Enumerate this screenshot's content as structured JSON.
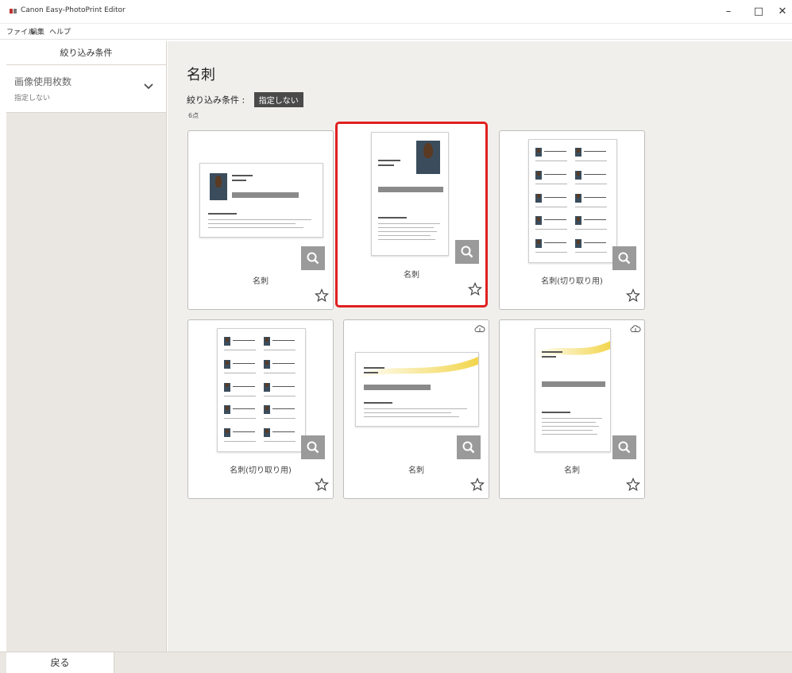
{
  "window": {
    "title": "Canon Easy-PhotoPrint Editor",
    "minimize": "–",
    "maximize": "□",
    "close": "✕"
  },
  "menu": [
    "ファイル",
    "編集",
    "ヘルプ"
  ],
  "sidebar": {
    "header": "絞り込み条件",
    "filter_title": "画像使用枚数",
    "filter_value": "指定しない"
  },
  "main": {
    "title": "名刺",
    "filter_label": "絞り込み条件 :",
    "filter_chip": "指定しない",
    "count": "6点"
  },
  "cards": [
    {
      "label": "名刺",
      "selected": false,
      "cloud": false
    },
    {
      "label": "名刺",
      "selected": true,
      "cloud": false
    },
    {
      "label": "名刺(切り取り用)",
      "selected": false,
      "cloud": false
    },
    {
      "label": "名刺(切り取り用)",
      "selected": false,
      "cloud": false
    },
    {
      "label": "名刺",
      "selected": false,
      "cloud": true
    },
    {
      "label": "名刺",
      "selected": false,
      "cloud": true
    }
  ],
  "footer": {
    "back": "戻る"
  },
  "colors": {
    "selection": "#e02020",
    "zoom_button": "#9a9a9a",
    "chip_bg": "#4a4a4a",
    "yellow_accent": "#f2d54a"
  },
  "icons": {
    "zoom": "magnifier-icon",
    "favorite": "star-outline-icon",
    "cloud": "cloud-download-icon",
    "dropdown": "chevron-down-icon"
  }
}
